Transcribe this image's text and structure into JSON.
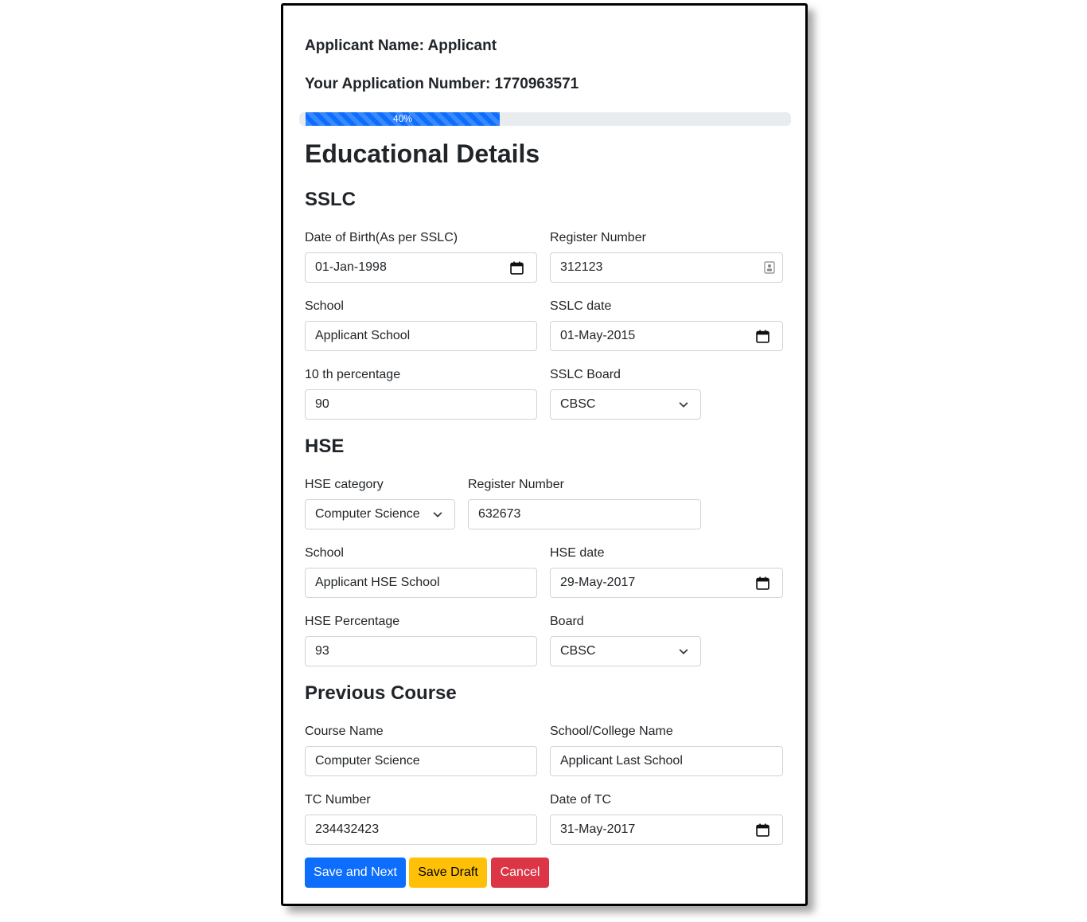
{
  "applicant_name_line": "Applicant Name: Applicant",
  "application_number_line": "Your Application Number: 1770963571",
  "progress": {
    "value": 40,
    "label": "40%"
  },
  "page_title": "Educational Details",
  "sslc": {
    "heading": "SSLC",
    "dob": {
      "label": "Date of Birth(As per SSLC)",
      "value": "01-Jan-1998"
    },
    "register_number": {
      "label": "Register Number",
      "value": "312123"
    },
    "school": {
      "label": "School",
      "value": "Applicant School"
    },
    "sslc_date": {
      "label": "SSLC date",
      "value": "01-May-2015"
    },
    "percentage": {
      "label": "10 th percentage",
      "value": "90"
    },
    "board": {
      "label": "SSLC Board",
      "value": "CBSC"
    }
  },
  "hse": {
    "heading": "HSE",
    "category": {
      "label": "HSE category",
      "value": "Computer Science"
    },
    "register_number": {
      "label": "Register Number",
      "value": "632673"
    },
    "school": {
      "label": "School",
      "value": "Applicant HSE School"
    },
    "hse_date": {
      "label": "HSE date",
      "value": "29-May-2017"
    },
    "percentage": {
      "label": "HSE Percentage",
      "value": "93"
    },
    "board": {
      "label": "Board",
      "value": "CBSC"
    }
  },
  "previous_course": {
    "heading": "Previous Course",
    "course_name": {
      "label": "Course Name",
      "value": "Computer Science"
    },
    "college_name": {
      "label": "School/College Name",
      "value": "Applicant Last School"
    },
    "tc_number": {
      "label": "TC Number",
      "value": "234432423"
    },
    "tc_date": {
      "label": "Date of TC",
      "value": "31-May-2017"
    }
  },
  "buttons": {
    "save_next": "Save and Next",
    "save_draft": "Save Draft",
    "cancel": "Cancel"
  },
  "colors": {
    "primary": "#0d6efd",
    "warning": "#ffc107",
    "danger": "#dc3545"
  }
}
